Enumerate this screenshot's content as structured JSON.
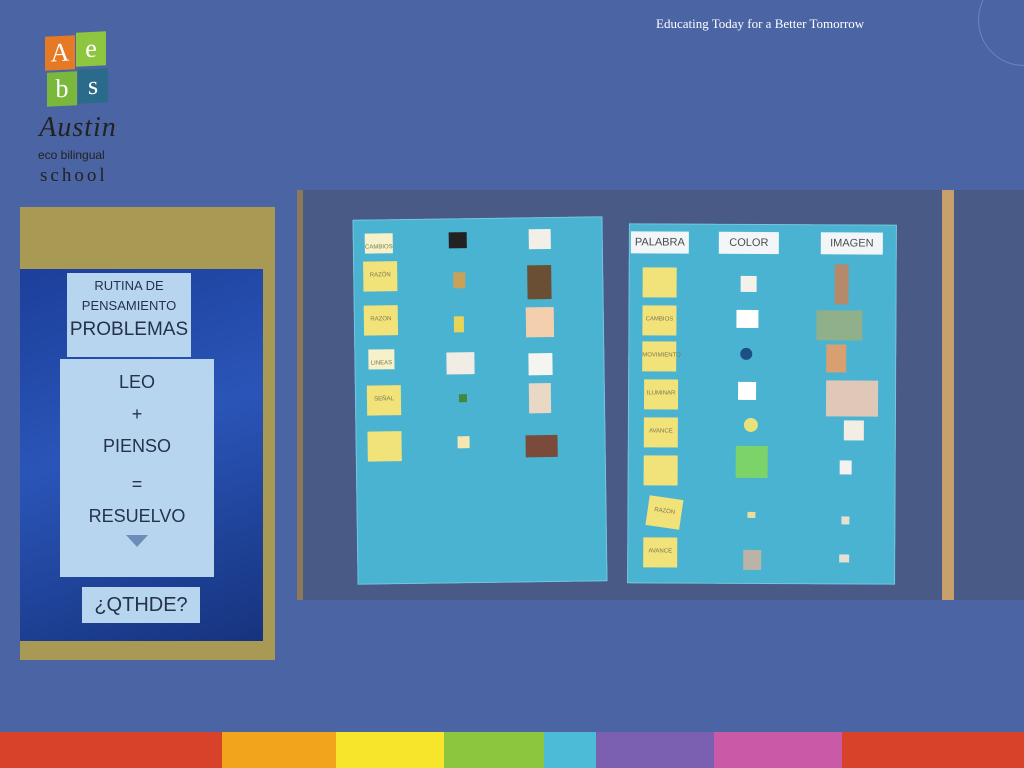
{
  "header": {
    "tagline": "Educating Today for a Better Tomorrow"
  },
  "logo": {
    "letters": [
      "A",
      "e",
      "b",
      "s"
    ],
    "script": "Austin",
    "subtitle": "eco bilingual",
    "school": "school"
  },
  "poster": {
    "title_line1": "RUTINA DE",
    "title_line2": "PENSAMIENTO",
    "title_line3": "PROBLEMAS",
    "steps": [
      "LEO",
      "+",
      "PIENSO",
      "=",
      "RESUELVO"
    ],
    "question": "¿QTHDE?"
  },
  "chart_board": {
    "headers": [
      "PALABRA",
      "COLOR",
      "IMAGEN"
    ],
    "left_notes": [
      "CAMBIOS",
      "RAZÓN",
      "RAZON",
      "LINEAS",
      "SEÑAL",
      ""
    ],
    "right_notes": [
      "",
      "CAMBIOS",
      "MOVIMIENTO",
      "ILUMINAR",
      "AVANCE MÁS",
      "",
      "RAZÓN",
      "AVANCE"
    ]
  },
  "colors": {
    "background": "#4a64a4",
    "rainbow": [
      "#d8412a",
      "#f2a51c",
      "#f6e52a",
      "#8cc63f",
      "#4bbbd8",
      "#7b5fb0",
      "#c85aa8",
      "#d8412a"
    ]
  }
}
